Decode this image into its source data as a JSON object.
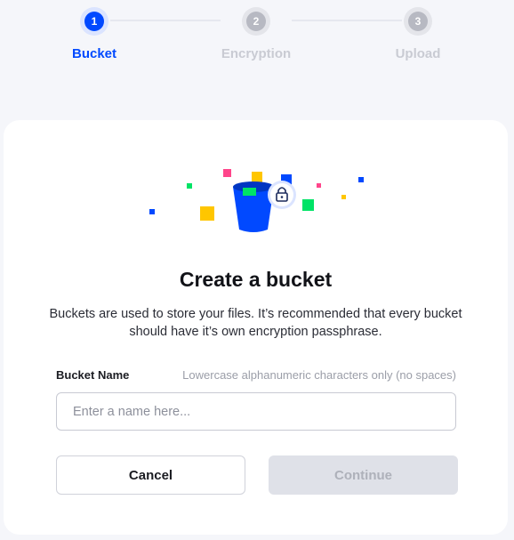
{
  "stepper": {
    "steps": [
      {
        "number": "1",
        "label": "Bucket",
        "state": "active"
      },
      {
        "number": "2",
        "label": "Encryption",
        "state": "inactive"
      },
      {
        "number": "3",
        "label": "Upload",
        "state": "inactive"
      }
    ]
  },
  "card": {
    "title": "Create a bucket",
    "description": "Buckets are used to store your files. It’s recommended that every bucket should have it’s own encryption passphrase.",
    "illustration_icon": "bucket-with-lock"
  },
  "form": {
    "field_label": "Bucket Name",
    "field_hint": "Lowercase alphanumeric characters only (no spaces)",
    "input_value": "",
    "input_placeholder": "Enter a name here..."
  },
  "actions": {
    "cancel_label": "Cancel",
    "continue_label": "Continue"
  },
  "colors": {
    "accent": "#0149ff",
    "page_background": "#f5f6fa",
    "card_background": "#ffffff",
    "disabled_button": "#dfe1e8"
  }
}
